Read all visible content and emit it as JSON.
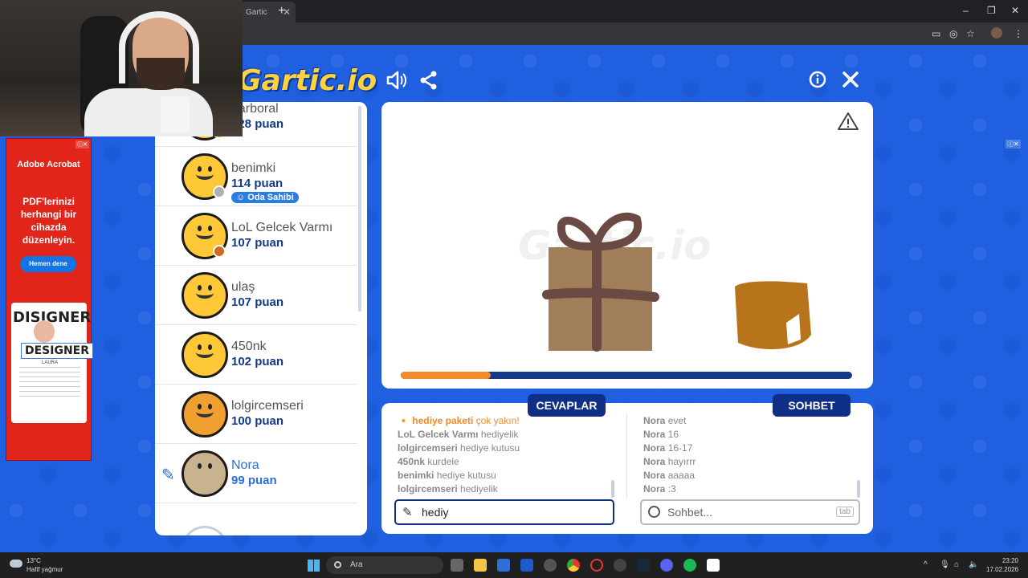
{
  "browser": {
    "tab_title": "Gartic",
    "tab_close": "✕",
    "new_tab": "+",
    "window_controls": [
      "–",
      "❐",
      "✕"
    ],
    "toolbar_icons": [
      "cast-icon",
      "eye-off-icon",
      "star-icon",
      "profile-avatar",
      "menu-icon"
    ]
  },
  "game": {
    "logo": "Gartic.io",
    "header_icons": [
      "volume-icon",
      "share-icon",
      "info-icon",
      "close-icon"
    ],
    "players": [
      {
        "name": "darboral",
        "score": "128 puan",
        "status_color": "#f5c518"
      },
      {
        "name": "benimki",
        "score": "114 puan",
        "badge": "Oda Sahibi",
        "status_color": "#b0b0b0"
      },
      {
        "name": "LoL Gelcek Varmı",
        "score": "107 puan",
        "status_color": "#d2691e"
      },
      {
        "name": "ulaş",
        "score": "107 puan"
      },
      {
        "name": "450nk",
        "score": "102 puan"
      },
      {
        "name": "lolgircemseri",
        "score": "100 puan"
      },
      {
        "name": "Nora",
        "score": "99 puan",
        "drawing": true
      }
    ],
    "progress": 0.2,
    "colors": {
      "primary": "#1f5fe0",
      "dark_blue": "#143a8a",
      "accent_orange": "#f58a2a"
    }
  },
  "answers": {
    "tab_label": "CEVAPLAR",
    "messages": [
      {
        "user": "hediye paketi",
        "text": "çok yakın!",
        "close": true
      },
      {
        "user": "LoL Gelcek Varmı",
        "text": "hediyelik"
      },
      {
        "user": "lolgircemseri",
        "text": "hediye kutusu"
      },
      {
        "user": "450nk",
        "text": "kurdele"
      },
      {
        "user": "benimki",
        "text": "hediye kutusu"
      },
      {
        "user": "lolgircemseri",
        "text": "hediyelik"
      }
    ],
    "input_value": "hediy"
  },
  "chat": {
    "tab_label": "SOHBET",
    "messages": [
      {
        "user": "Nora",
        "text": "evet"
      },
      {
        "user": "Nora",
        "text": "16"
      },
      {
        "user": "Nora",
        "text": "16-17"
      },
      {
        "user": "Nora",
        "text": "hayırrr"
      },
      {
        "user": "Nora",
        "text": "aaaaa"
      },
      {
        "user": "Nora",
        "text": ":3"
      }
    ],
    "input_placeholder": "Sohbet...",
    "tab_key": "tab"
  },
  "ad": {
    "brand": "Adobe Acrobat",
    "text": "PDF'lerinizi herhangi bir cihazda düzenleyin.",
    "button": "Hemen dene",
    "card_title_1": "DISIGNER",
    "card_title_2": "DESIGNER",
    "card_caption": "LAURA"
  },
  "taskbar": {
    "temperature": "13°C",
    "weather": "Hafif yağmur",
    "search_label": "Ara",
    "time": "23:20",
    "date": "17.02.2026"
  }
}
